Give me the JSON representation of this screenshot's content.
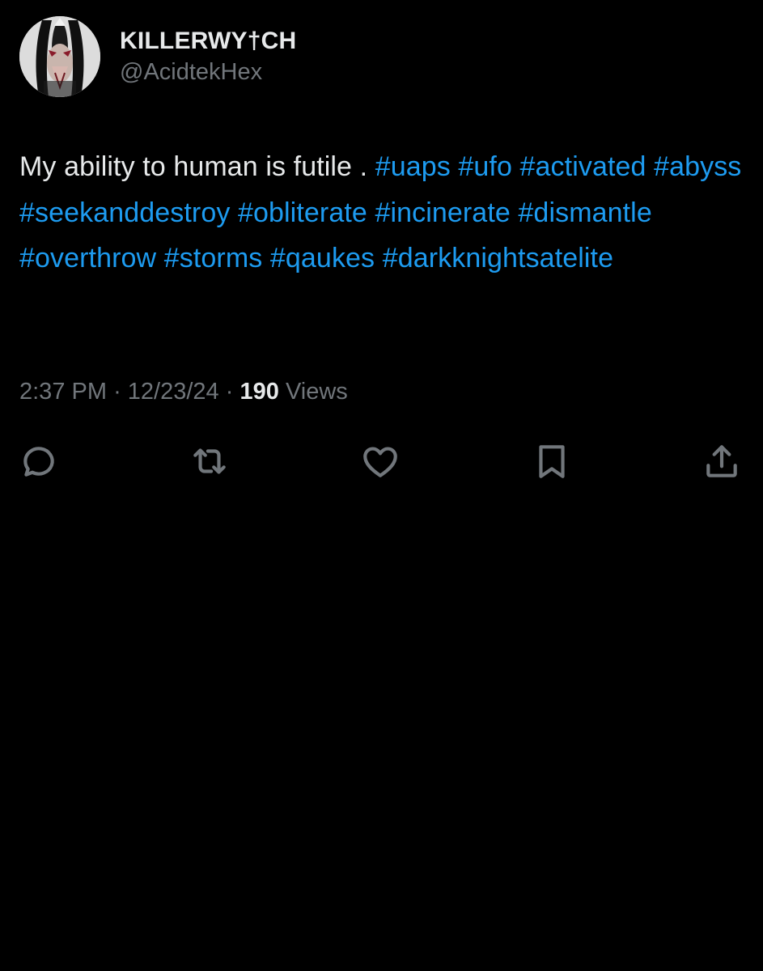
{
  "user": {
    "display_name": "KILLERWY†CH",
    "handle": "@AcidtekHex"
  },
  "tweet": {
    "text_parts": [
      {
        "text": "My ability to human is futile . ",
        "type": "text"
      },
      {
        "text": "#uaps",
        "type": "hashtag"
      },
      {
        "text": " ",
        "type": "text"
      },
      {
        "text": "#ufo",
        "type": "hashtag"
      },
      {
        "text": " ",
        "type": "text"
      },
      {
        "text": "#activated",
        "type": "hashtag"
      },
      {
        "text": " ",
        "type": "text"
      },
      {
        "text": "#abyss",
        "type": "hashtag"
      },
      {
        "text": " ",
        "type": "text"
      },
      {
        "text": "#seekanddestroy",
        "type": "hashtag"
      },
      {
        "text": " ",
        "type": "text"
      },
      {
        "text": "#obliterate",
        "type": "hashtag"
      },
      {
        "text": " ",
        "type": "text"
      },
      {
        "text": "#incinerate",
        "type": "hashtag"
      },
      {
        "text": " ",
        "type": "text"
      },
      {
        "text": "#dismantle",
        "type": "hashtag"
      },
      {
        "text": " ",
        "type": "text"
      },
      {
        "text": "#overthrow",
        "type": "hashtag"
      },
      {
        "text": " ",
        "type": "text"
      },
      {
        "text": "#storms",
        "type": "hashtag"
      },
      {
        "text": " ",
        "type": "text"
      },
      {
        "text": "#qaukes",
        "type": "hashtag"
      },
      {
        "text": " ",
        "type": "text"
      },
      {
        "text": "#darkknightsatelite",
        "type": "hashtag"
      }
    ],
    "time": "2:37 PM",
    "date": "12/23/24",
    "separator": "·",
    "views_count": "190",
    "views_label": "Views"
  },
  "actions": [
    {
      "icon": "reply-icon"
    },
    {
      "icon": "retweet-icon"
    },
    {
      "icon": "like-icon"
    },
    {
      "icon": "bookmark-icon"
    },
    {
      "icon": "share-icon"
    }
  ],
  "colors": {
    "background": "#000000",
    "primary_text": "#e7e9ea",
    "secondary_text": "#71767b",
    "hashtag": "#1d9bf0",
    "icon": "#71767b"
  }
}
